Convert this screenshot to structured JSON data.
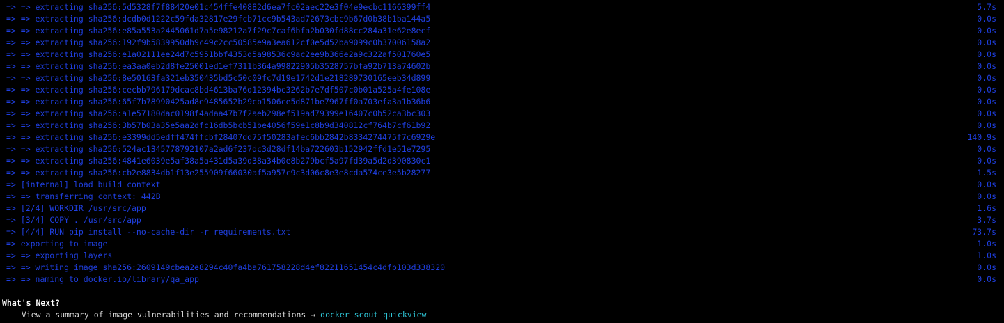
{
  "colors": {
    "background": "#000000",
    "log_text": "#1f3fe0",
    "heading": "#ffffff",
    "hint_text": "#d8d8d8",
    "command": "#2fc6d8"
  },
  "build_log": [
    {
      "text": "=> => extracting sha256:5d5328f7f88420e01c454ffe40882d6ea7fc02aec22e3f04e9ecbc1166399ff4",
      "duration": "5.7s"
    },
    {
      "text": "=> => extracting sha256:dcdb0d1222c59fda32817e29fcb71cc9b543ad72673cbc9b67d0b38b1ba144a5",
      "duration": "0.0s"
    },
    {
      "text": "=> => extracting sha256:e85a553a2445061d7a5e98212a7f29c7caf6bfa2b030fd88cc284a31e62e8ecf",
      "duration": "0.0s"
    },
    {
      "text": "=> => extracting sha256:192f9b5839950db9c49c2cc50585e9a3ea612cf0e5d52ba9099c0b37006158a2",
      "duration": "0.0s"
    },
    {
      "text": "=> => extracting sha256:e1a02111ee24d7c5951bbf4353d5a98536c9ac2ee9b366e2a9c322af501760e5",
      "duration": "0.0s"
    },
    {
      "text": "=> => extracting sha256:ea3aa0eb2d8fe25001ed1ef7311b364a99822905b3528757bfa92b713a74602b",
      "duration": "0.0s"
    },
    {
      "text": "=> => extracting sha256:8e50163fa321eb350435bd5c50c09fc7d19e1742d1e218289730165eeb34d899",
      "duration": "0.0s"
    },
    {
      "text": "=> => extracting sha256:cecbb796179dcac8bd4613ba76d12394bc3262b7e7df507c0b01a525a4fe108e",
      "duration": "0.0s"
    },
    {
      "text": "=> => extracting sha256:65f7b78990425ad8e9485652b29cb1506ce5d871be7967ff0a703efa3a1b36b6",
      "duration": "0.0s"
    },
    {
      "text": "=> => extracting sha256:a1e57180dac0198f4adaa47b7f2aeb298ef519ad79399e16407c0b52ca3bc303",
      "duration": "0.0s"
    },
    {
      "text": "=> => extracting sha256:3b57b03a35e5aa2dfc16db5bcb51be4056f59e1c8b9d340812cf764b7cf61b92",
      "duration": "0.0s"
    },
    {
      "text": "=> => extracting sha256:e3399dd5edff474ffcbf28407dd75f50283afec6bb2842b8334274475f7c6929e",
      "duration": "140.9s"
    },
    {
      "text": "=> => extracting sha256:524ac1345778792107a2ad6f237dc3d28df14ba722603b152942ffd1e51e7295",
      "duration": "0.0s"
    },
    {
      "text": "=> => extracting sha256:4841e6039e5af38a5a431d5a39d38a34b0e8b279bcf5a97fd39a5d2d390830c1",
      "duration": "0.0s"
    },
    {
      "text": "=> => extracting sha256:cb2e8834db1f13e255909f66030af5a957c9c3d06c8e3e8cda574ce3e5b28277",
      "duration": "1.5s"
    },
    {
      "text": "=> [internal] load build context",
      "duration": "0.0s"
    },
    {
      "text": "=> => transferring context: 442B",
      "duration": "0.0s"
    },
    {
      "text": "=> [2/4] WORKDIR /usr/src/app",
      "duration": "1.6s"
    },
    {
      "text": "=> [3/4] COPY . /usr/src/app",
      "duration": "3.7s"
    },
    {
      "text": "=> [4/4] RUN pip install --no-cache-dir -r requirements.txt",
      "duration": "73.7s"
    },
    {
      "text": "=> exporting to image",
      "duration": "1.0s"
    },
    {
      "text": "=> => exporting layers",
      "duration": "1.0s"
    },
    {
      "text": "=> => writing image sha256:2609149cbea2e8294c40fa4ba761758228d4ef82211651454c4dfb103d338320",
      "duration": "0.0s"
    },
    {
      "text": "=> => naming to docker.io/library/qa_app",
      "duration": "0.0s"
    }
  ],
  "whats_next": {
    "heading": "What's Next?",
    "hint_text": "  View a summary of image vulnerabilities and recommendations ",
    "arrow": "→",
    "command": "docker scout quickview"
  }
}
